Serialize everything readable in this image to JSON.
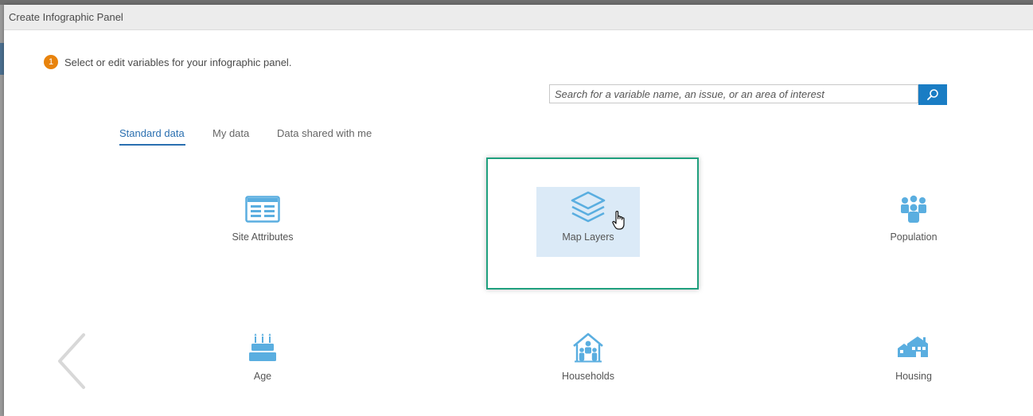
{
  "dialog": {
    "title": "Create Infographic Panel"
  },
  "step": {
    "number": "1",
    "text": "Select or edit variables for your infographic panel."
  },
  "search": {
    "placeholder": "Search for a variable name, an issue, or an area of interest",
    "value": ""
  },
  "tabs": [
    {
      "label": "Standard data",
      "active": true
    },
    {
      "label": "My data",
      "active": false
    },
    {
      "label": "Data shared with me",
      "active": false
    }
  ],
  "categories": [
    {
      "label": "Site Attributes",
      "icon": "table-icon",
      "selected": false
    },
    {
      "label": "Map Layers",
      "icon": "layers-icon",
      "selected": true
    },
    {
      "label": "Population",
      "icon": "people-icon",
      "selected": false
    },
    {
      "label": "Age",
      "icon": "cake-icon",
      "selected": false
    },
    {
      "label": "Households",
      "icon": "house-family-icon",
      "selected": false
    },
    {
      "label": "Housing",
      "icon": "houses-icon",
      "selected": false
    }
  ],
  "colors": {
    "accent": "#1a7dc4",
    "tab_active": "#2a6fb0",
    "step_badge": "#e8830c",
    "highlight": "#1fa07e",
    "icon": "#5aaee0",
    "selected_tile": "#dbeaf7"
  }
}
